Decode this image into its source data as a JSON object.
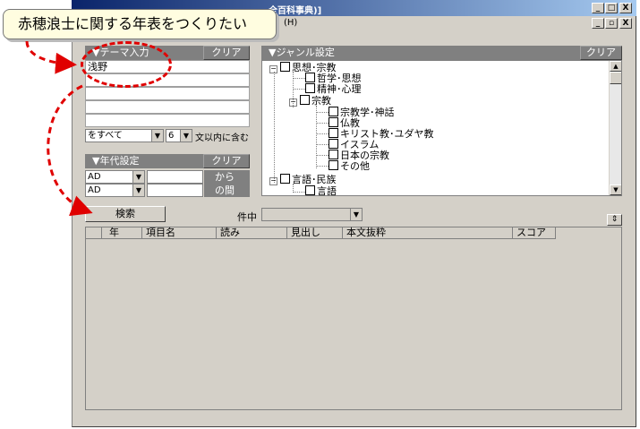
{
  "window": {
    "title": "全百科事典)]",
    "menu_help": "(H)",
    "min": "_",
    "max": "□",
    "close": "X",
    "restore": "▫"
  },
  "callout": {
    "text": "赤穂浪士に関する年表をつくりたい"
  },
  "theme": {
    "header": "▼テーマ入力",
    "clear": "クリア",
    "rows": [
      "浅野",
      "",
      "",
      "",
      ""
    ],
    "match_select": "をすべて",
    "length_select": "6",
    "suffix": "文以内に含む"
  },
  "era": {
    "header": "▼年代設定",
    "clear": "クリア",
    "from_era": "AD",
    "to_era": "AD",
    "from_label": "から",
    "to_label": "の間"
  },
  "genre": {
    "header": "▼ジャンル設定",
    "clear": "クリア",
    "nodes": {
      "n1": "思想･宗教",
      "n1_1": "哲学･思想",
      "n1_2": "精神･心理",
      "n1_3": "宗教",
      "n1_3_1": "宗教学･神話",
      "n1_3_2": "仏教",
      "n1_3_3": "キリスト教･ユダヤ教",
      "n1_3_4": "イスラム",
      "n1_3_5": "日本の宗教",
      "n1_3_6": "その他",
      "n2": "言語･民族",
      "n2_1": "言語"
    }
  },
  "search": {
    "button": "検索",
    "count_label": "件中",
    "count_value": ""
  },
  "results": {
    "columns": [
      "年",
      "項目名",
      "読み",
      "見出し",
      "本文抜粋",
      "スコア"
    ]
  },
  "icons": {
    "tree_collapse": "−",
    "dropdown": "▼",
    "scroll_up": "▲",
    "scroll_down": "▼",
    "sort_toggle": "⇕"
  }
}
